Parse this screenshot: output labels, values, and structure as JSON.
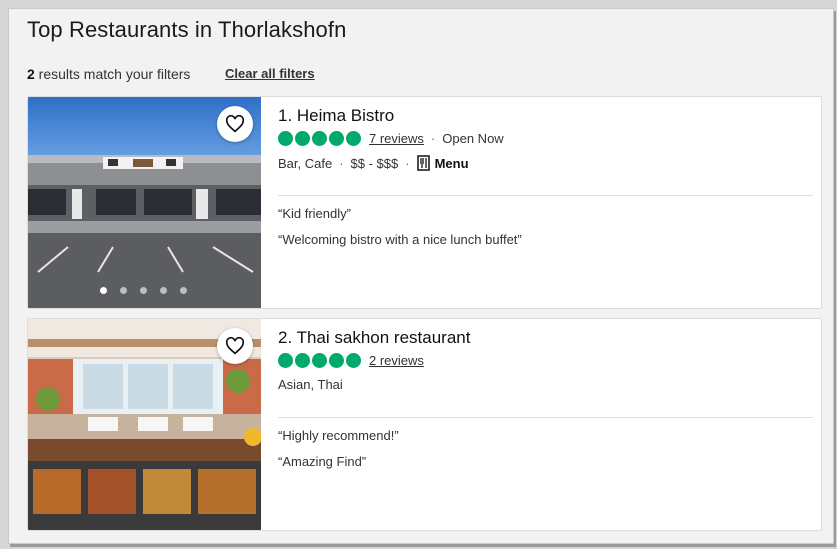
{
  "page": {
    "title": "Top Restaurants in Thorlakshofn",
    "result_count": "2",
    "results_text": " results match your filters",
    "clear_filters": "Clear all filters"
  },
  "restaurants": [
    {
      "name": "1. Heima Bistro",
      "rating": 5,
      "reviews": "7 reviews",
      "status": "Open Now",
      "cuisine": "Bar, Cafe",
      "price": "$$ - $$$",
      "menu_label": "Menu",
      "quotes": [
        "“Kid friendly”",
        "“Welcoming bistro with a nice lunch buffet”"
      ],
      "photo_count": 5,
      "active_photo": 1
    },
    {
      "name": "2. Thai sakhon restaurant",
      "rating": 5,
      "reviews": "2 reviews",
      "cuisine": "Asian, Thai",
      "quotes": [
        "“Highly recommend!”",
        "“Amazing Find”"
      ]
    }
  ],
  "colors": {
    "rating_bubble": "#00aa6c",
    "background": "#f2f2f2"
  },
  "icons": {
    "save": "heart-icon",
    "menu": "menu-icon"
  }
}
